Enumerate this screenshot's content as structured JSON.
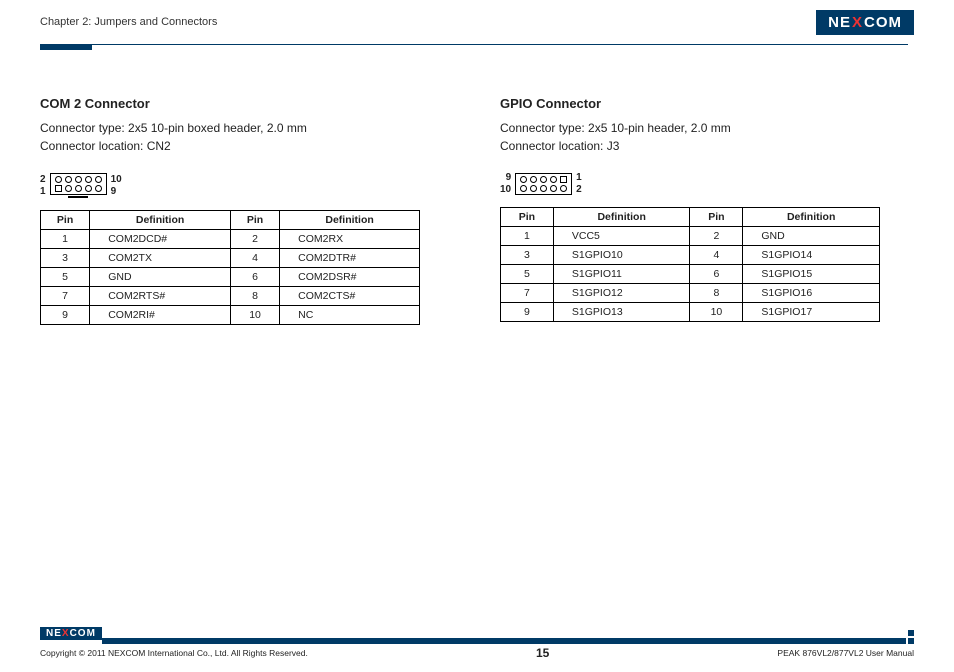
{
  "header": {
    "chapter": "Chapter 2: Jumpers and Connectors",
    "logo": {
      "left": "NE",
      "x": "X",
      "right": "COM"
    }
  },
  "left": {
    "title": "COM 2 Connector",
    "type": "Connector type: 2x5 10-pin boxed header, 2.0 mm",
    "location": "Connector location: CN2",
    "diag": {
      "tl": "2",
      "bl": "1",
      "tr": "10",
      "br": "9"
    },
    "headers": {
      "pin": "Pin",
      "def": "Definition"
    },
    "rows": [
      {
        "p1": "1",
        "d1": "COM2DCD#",
        "p2": "2",
        "d2": "COM2RX"
      },
      {
        "p1": "3",
        "d1": "COM2TX",
        "p2": "4",
        "d2": "COM2DTR#"
      },
      {
        "p1": "5",
        "d1": "GND",
        "p2": "6",
        "d2": "COM2DSR#"
      },
      {
        "p1": "7",
        "d1": "COM2RTS#",
        "p2": "8",
        "d2": "COM2CTS#"
      },
      {
        "p1": "9",
        "d1": "COM2RI#",
        "p2": "10",
        "d2": "NC"
      }
    ]
  },
  "right": {
    "title": "GPIO Connector",
    "type": "Connector type: 2x5 10-pin header, 2.0 mm",
    "location": "Connector location: J3",
    "diag": {
      "tl": "9",
      "bl": "10",
      "tr": "1",
      "br": "2"
    },
    "headers": {
      "pin": "Pin",
      "def": "Definition"
    },
    "rows": [
      {
        "p1": "1",
        "d1": "VCC5",
        "p2": "2",
        "d2": "GND"
      },
      {
        "p1": "3",
        "d1": "S1GPIO10",
        "p2": "4",
        "d2": "S1GPIO14"
      },
      {
        "p1": "5",
        "d1": "S1GPIO11",
        "p2": "6",
        "d2": "S1GPIO15"
      },
      {
        "p1": "7",
        "d1": "S1GPIO12",
        "p2": "8",
        "d2": "S1GPIO16"
      },
      {
        "p1": "9",
        "d1": "S1GPIO13",
        "p2": "10",
        "d2": "S1GPIO17"
      }
    ]
  },
  "footer": {
    "copyright": "Copyright © 2011 NEXCOM International Co., Ltd. All Rights Reserved.",
    "page": "15",
    "manual": "PEAK 876VL2/877VL2 User Manual"
  }
}
